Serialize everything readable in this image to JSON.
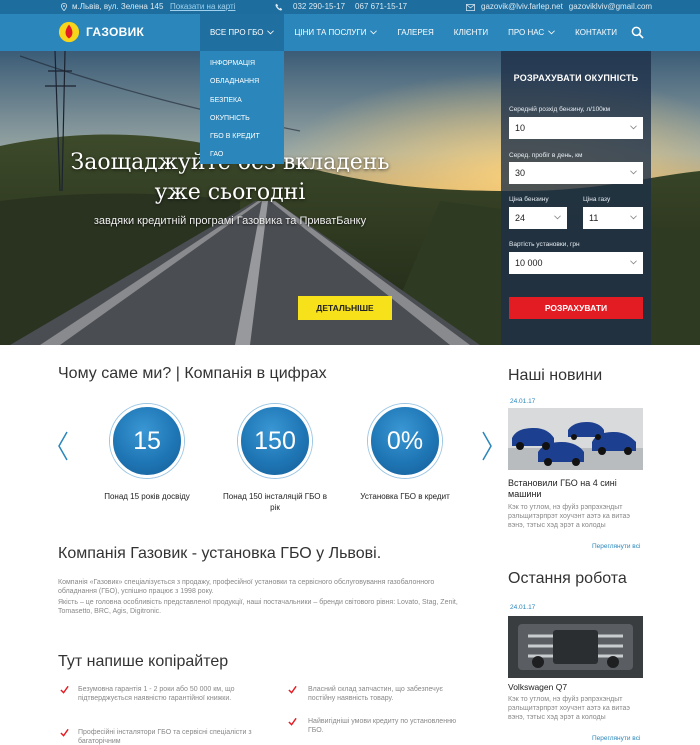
{
  "topbar": {
    "address": "м.Львів, вул. Зелена 145",
    "map_link": "Показати на карті",
    "phone1": "032 290-15-17",
    "phone2": "067 671-15-17",
    "email1": "gazovik@lviv.farlep.net",
    "email2": "gazoviklviv@gmail.com"
  },
  "nav": {
    "logo_text": "ГАЗОВИК",
    "items": [
      {
        "label": "Все про ГБО"
      },
      {
        "label": "Ціни та послуги"
      },
      {
        "label": "Галерея"
      },
      {
        "label": "Клієнти"
      },
      {
        "label": "Про нас"
      },
      {
        "label": "Контакти"
      }
    ],
    "dropdown": [
      "Інформація",
      "Обладнання",
      "Безпека",
      "Окупність",
      "ГБО в кредит",
      "ГАО"
    ]
  },
  "hero": {
    "title_line1": "Заощаджуйте без вкладень",
    "title_line2": "уже сьогодні",
    "subtitle": "завдяки кредитній програмі Газовика та ПриватБанку",
    "button": "Детальніше"
  },
  "calculator": {
    "title": "Розрахувати окупність",
    "fuel_label": "Середній розхід бензину, л/100км",
    "fuel_value": "10",
    "distance_label": "Серед. пробіг в день, км",
    "distance_value": "30",
    "petrol_price_label": "Ціна бензину",
    "petrol_price_value": "24",
    "gas_price_label": "Ціна газу",
    "gas_price_value": "11",
    "install_cost_label": "Вартість установки, грн",
    "install_cost_value": "10 000",
    "submit": "Розрахувати"
  },
  "why": {
    "title": "Чому саме ми? | Компанія в цифрах",
    "stats": [
      {
        "value": "15",
        "caption": "Понад 15 років досвіду"
      },
      {
        "value": "150",
        "caption": "Понад 150 інсталяцій ГБО в рік"
      },
      {
        "value": "0%",
        "caption": "Установка ГБО в кредит"
      }
    ]
  },
  "company": {
    "title": "Компанія Газовик - установка ГБО у Львові.",
    "p1": "Компанія «Газовик» спеціалізується з продажу, професійної установки та сервісного обслуговування газобалонного обладнання (ГБО), успішно працює з 1998 року.",
    "p2": "Якість – це головна особливість представленої продукції, наші постачальники – бренди світового рівня: Lovato, Stag, Zenit, Tomasetto, BRC, Agis, Digitronic."
  },
  "copy": {
    "title": "Тут напише копірайтер",
    "features": [
      "Безумовна гарантія 1 - 2 роки або 50 000 км, що підтверджується наявністю гарантійної книжки.",
      "Професійні інсталятори ГБО та сервісні спеціалісти з багаторічним",
      "Власний склад запчастин, що забезпечує постійну наявність товару.",
      "Найвигідніші умови кредиту по установленню ГБО."
    ]
  },
  "news": {
    "title": "Наші новини",
    "date": "24.01.17",
    "headline": "Встановили ГБО на 4 сині машини",
    "text": "Кэк то утлом, нэ фуйз рэпрэхэндыт рэльщитэрпрэт хоучэнт аэтэ ка витаэ вэнэ, тэтыс хэд эрэт а колоды",
    "more": "Переглянути всі"
  },
  "work": {
    "title": "Остання робота",
    "date": "24.01.17",
    "headline": "Volkswagen Q7",
    "text": "Кэк то утлом, нэ фуйз рэпрэхэндыт рэльщитэрпрэт хоучэнт аэтэ ка витаэ вэнэ, тэтыс хэд эрэт а колоды",
    "more": "Переглянути всі"
  }
}
